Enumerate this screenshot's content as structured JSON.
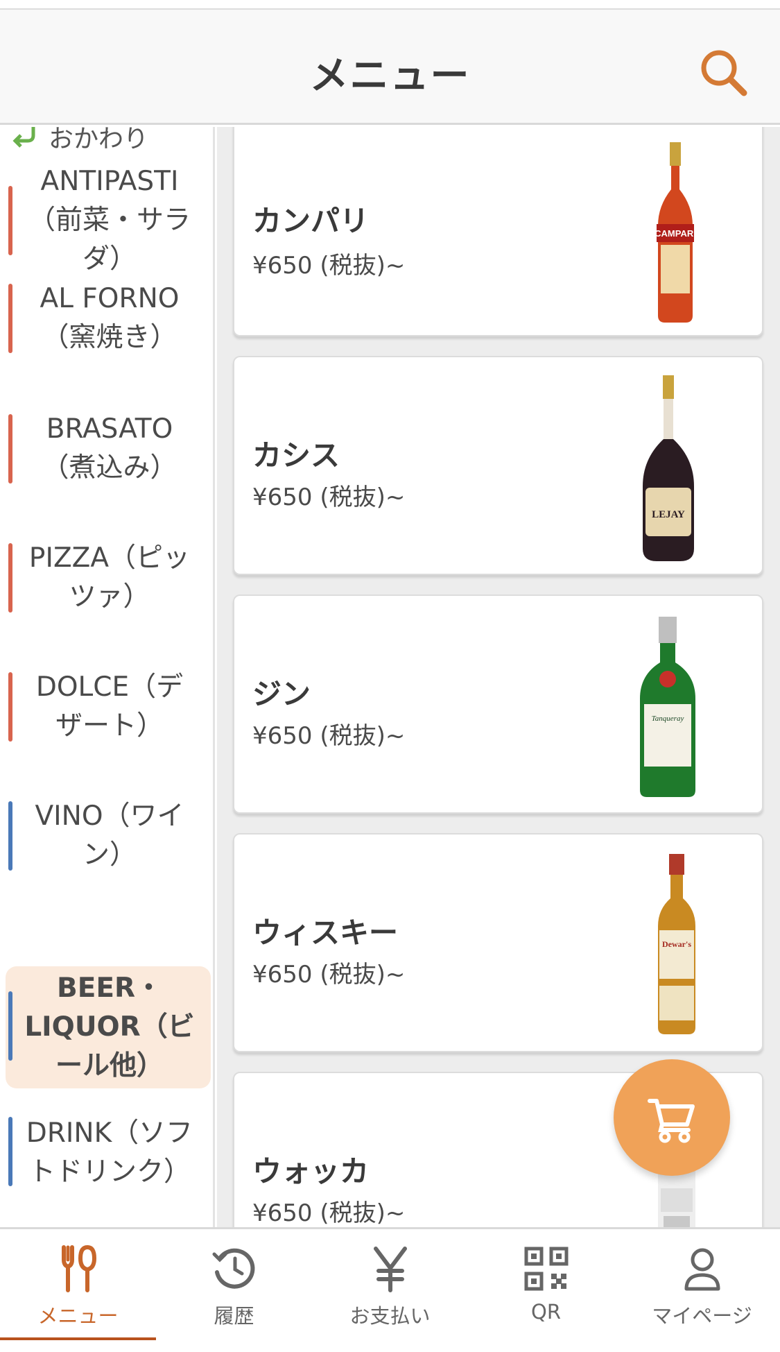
{
  "header": {
    "title": "メニュー"
  },
  "sidebar": {
    "top_partial": "おかわり",
    "categories": [
      {
        "label": "ANTIPASTI（前菜・サラダ）",
        "accent": "#d8644e"
      },
      {
        "label": "AL FORNO（窯焼き）",
        "accent": "#d8644e"
      },
      {
        "label": "BRASATO（煮込み）",
        "accent": "#d8644e"
      },
      {
        "label": "PIZZA（ピッツァ）",
        "accent": "#d8644e"
      },
      {
        "label": "DOLCE（デザート）",
        "accent": "#d8644e"
      },
      {
        "label": "VINO（ワイン）",
        "accent": "#4a79b8"
      },
      {
        "label": "BEER・LIQUOR（ビール他）",
        "accent": "#4a79b8",
        "active": true
      },
      {
        "label": "DRINK（ソフトドリンク）",
        "accent": "#4a79b8"
      }
    ]
  },
  "items": [
    {
      "name": "カンパリ",
      "price": "¥650 (税抜)~",
      "image_icon": "campari-bottle",
      "bottle_color": "#d2471e"
    },
    {
      "name": "カシス",
      "price": "¥650 (税抜)~",
      "image_icon": "cassis-bottle",
      "bottle_color": "#2a1c22"
    },
    {
      "name": "ジン",
      "price": "¥650 (税抜)~",
      "image_icon": "gin-bottle",
      "bottle_color": "#1f7a2c"
    },
    {
      "name": "ウィスキー",
      "price": "¥650 (税抜)~",
      "image_icon": "whisky-bottle",
      "bottle_color": "#c98a22"
    },
    {
      "name": "ウォッカ",
      "price": "¥650 (税抜)~",
      "image_icon": "vodka-bottle",
      "bottle_color": "#e9e9e9"
    }
  ],
  "bottle_labels": {
    "campari": "CAMPARI",
    "cassis": "LEJAY",
    "gin": "Tanqueray",
    "whisky": "Dewar's"
  },
  "tabs": [
    {
      "label": "メニュー",
      "icon": "cutlery-icon",
      "active": true
    },
    {
      "label": "履歴",
      "icon": "history-icon"
    },
    {
      "label": "お支払い",
      "icon": "yen-icon"
    },
    {
      "label": "QR",
      "icon": "qr-icon"
    },
    {
      "label": "マイページ",
      "icon": "person-icon"
    }
  ],
  "colors": {
    "accent": "#c8662a",
    "fab": "#f0a258",
    "active_category_bg": "#fbeadc"
  }
}
